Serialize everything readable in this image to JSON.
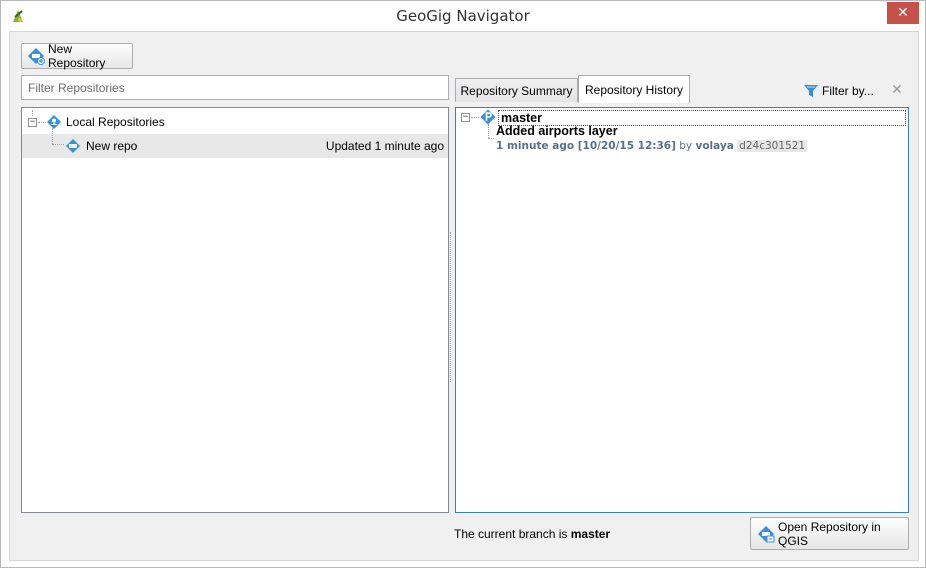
{
  "window": {
    "title": "GeoGig Navigator",
    "close_glyph": "✕"
  },
  "toolbar": {
    "new_repository_label": "New Repository"
  },
  "filter": {
    "placeholder": "Filter Repositories"
  },
  "tree": {
    "local_label": "Local Repositories",
    "repos": [
      {
        "label": "New repo",
        "status": "Updated 1 minute ago"
      }
    ]
  },
  "tabs": [
    {
      "label": "Repository Summary",
      "active": false
    },
    {
      "label": "Repository History",
      "active": true
    }
  ],
  "history_toolbar": {
    "filter_label": "Filter by...",
    "clear_glyph": "✕"
  },
  "history": {
    "branch": "master",
    "commit": {
      "message": "Added airports layer",
      "when": "1 minute ago [10/20/15 12:36]",
      "by_word": "by",
      "author": "volaya",
      "hash": "d24c301521"
    }
  },
  "footer": {
    "current_branch_prefix": "The current branch is",
    "current_branch": "master",
    "open_button_label": "Open Repository in QGIS"
  },
  "colors": {
    "accent": "#3c7fb1",
    "repo_icon": "#3a8fd9",
    "close_button": "#c7504b",
    "meta_text": "#55708e"
  },
  "icons": {
    "app": "geogig-logo-icon",
    "new_repo": "new-repository-icon",
    "local_repos": "local-repositories-icon",
    "repo": "repository-icon",
    "branch": "branch-icon",
    "filter": "funnel-icon",
    "open": "open-repository-icon"
  }
}
